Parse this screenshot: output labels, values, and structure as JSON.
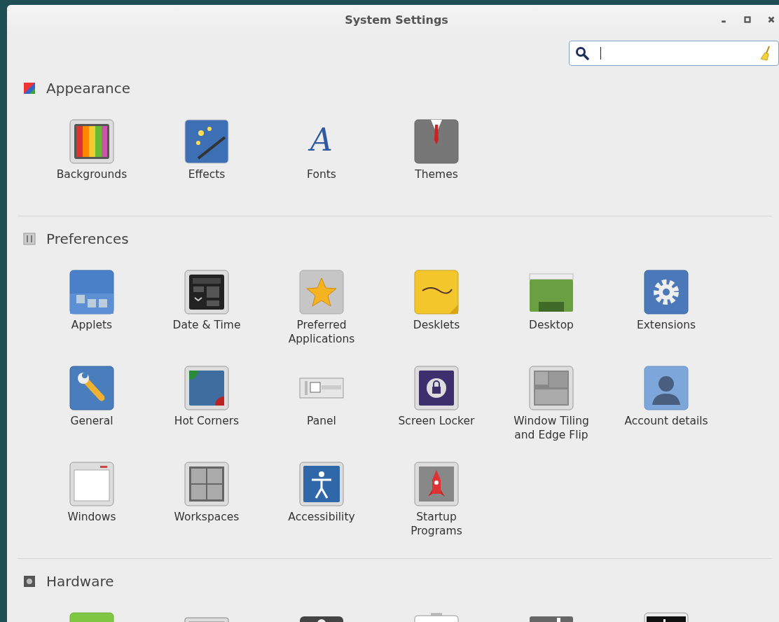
{
  "window": {
    "title": "System Settings"
  },
  "search": {
    "caret": true
  },
  "sections": [
    {
      "title": "Appearance",
      "kind": "appearance",
      "items": [
        {
          "label": "Backgrounds",
          "kind": "backgrounds"
        },
        {
          "label": "Effects",
          "kind": "effects"
        },
        {
          "label": "Fonts",
          "kind": "fonts",
          "glyph": "A"
        },
        {
          "label": "Themes",
          "kind": "themes"
        }
      ]
    },
    {
      "title": "Preferences",
      "kind": "preferences",
      "items": [
        {
          "label": "Applets",
          "kind": "applets"
        },
        {
          "label": "Date & Time",
          "kind": "datetime"
        },
        {
          "label": "Preferred Applications",
          "kind": "preferred"
        },
        {
          "label": "Desklets",
          "kind": "desklets"
        },
        {
          "label": "Desktop",
          "kind": "desktop"
        },
        {
          "label": "Extensions",
          "kind": "extensions"
        },
        {
          "label": "General",
          "kind": "general"
        },
        {
          "label": "Hot Corners",
          "kind": "hotcorners"
        },
        {
          "label": "Panel",
          "kind": "panel"
        },
        {
          "label": "Screen Locker",
          "kind": "locker"
        },
        {
          "label": "Window Tiling and Edge Flip",
          "kind": "tiling"
        },
        {
          "label": "Account details",
          "kind": "account"
        },
        {
          "label": "Windows",
          "kind": "windows"
        },
        {
          "label": "Workspaces",
          "kind": "workspaces"
        },
        {
          "label": "Accessibility",
          "kind": "accessibility"
        },
        {
          "label": "Startup Programs",
          "kind": "startup"
        }
      ]
    },
    {
      "title": "Hardware",
      "kind": "hardware",
      "items": [
        {
          "kind": "hw-green"
        },
        {
          "kind": "hw-keyboard"
        },
        {
          "kind": "hw-mouse"
        },
        {
          "kind": "hw-battery"
        },
        {
          "kind": "hw-grey"
        },
        {
          "kind": "hw-terminal"
        }
      ]
    }
  ]
}
